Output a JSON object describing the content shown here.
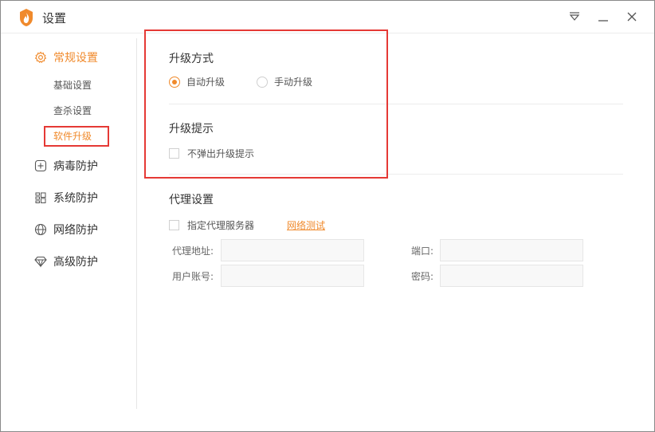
{
  "window": {
    "title": "设置"
  },
  "sidebar": {
    "groups": [
      {
        "label": "常规设置",
        "icon": "gear-icon",
        "active": true,
        "subitems": [
          {
            "label": "基础设置"
          },
          {
            "label": "查杀设置"
          },
          {
            "label": "软件升级",
            "active": true
          }
        ]
      },
      {
        "label": "病毒防护",
        "icon": "plus-square-icon"
      },
      {
        "label": "系统防护",
        "icon": "grid-icon"
      },
      {
        "label": "网络防护",
        "icon": "globe-icon"
      },
      {
        "label": "高级防护",
        "icon": "diamond-icon"
      }
    ]
  },
  "upgrade": {
    "method_title": "升级方式",
    "auto_label": "自动升级",
    "manual_label": "手动升级",
    "selected": "auto",
    "prompt_title": "升级提示",
    "no_popup_label": "不弹出升级提示",
    "no_popup_checked": false
  },
  "proxy": {
    "title": "代理设置",
    "enable_label": "指定代理服务器",
    "enable_checked": false,
    "test_link": "网络测试",
    "address_label": "代理地址:",
    "port_label": "端口:",
    "user_label": "用户账号:",
    "password_label": "密码:",
    "address_value": "",
    "port_value": "",
    "user_value": "",
    "password_value": ""
  },
  "colors": {
    "accent": "#f08a2c",
    "highlight": "#e53935"
  }
}
